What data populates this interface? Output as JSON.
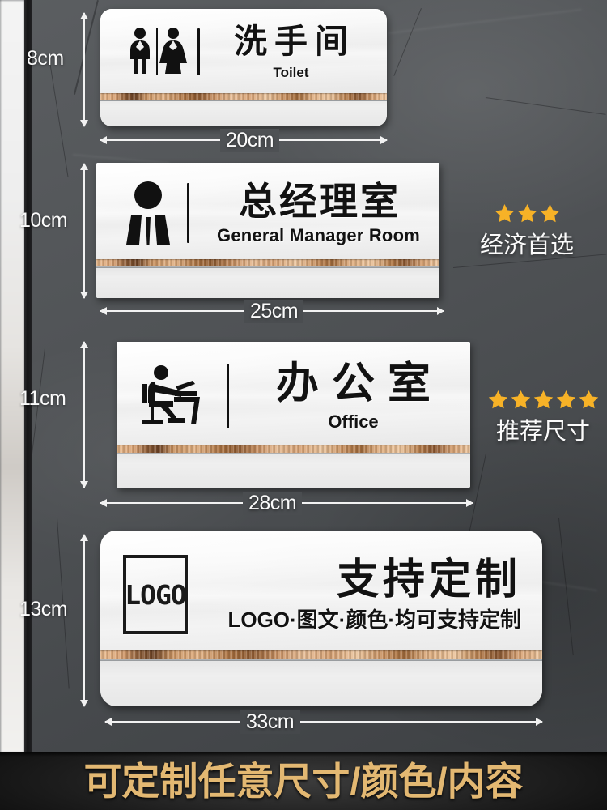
{
  "page": {
    "title": "Acrylic Door Sign Size Chart"
  },
  "signs": [
    {
      "id": "toilet",
      "icon": "male-female-restroom-icon",
      "cn": "洗手间",
      "en": "Toilet",
      "height_label": "8cm",
      "width_label": "20cm"
    },
    {
      "id": "general-manager",
      "icon": "manager-suit-icon",
      "cn": "总经理室",
      "en": "General Manager Room",
      "height_label": "10cm",
      "width_label": "25cm"
    },
    {
      "id": "office",
      "icon": "person-at-desk-icon",
      "cn": "办公室",
      "en": "Office",
      "height_label": "11cm",
      "width_label": "28cm"
    },
    {
      "id": "custom",
      "icon": "logo-placeholder-icon",
      "logo_text": "LOGO",
      "cn": "支持定制",
      "en": "LOGO·图文·颜色·均可支持定制",
      "height_label": "13cm",
      "width_label": "33cm"
    }
  ],
  "badges": [
    {
      "id": "economy",
      "stars": 3,
      "text": "经济首选"
    },
    {
      "id": "recommended",
      "stars": 5,
      "text": "推荐尺寸"
    }
  ],
  "banner": {
    "text": "可定制任意尺寸/颜色/内容"
  },
  "colors": {
    "star": "#F7B227",
    "banner_text": "#E3B872",
    "wall": "#4e5154",
    "plate": "#efefef",
    "wood": "#d9a374",
    "sign_text": "#121212",
    "dimension_line": "#f2f2f2"
  }
}
